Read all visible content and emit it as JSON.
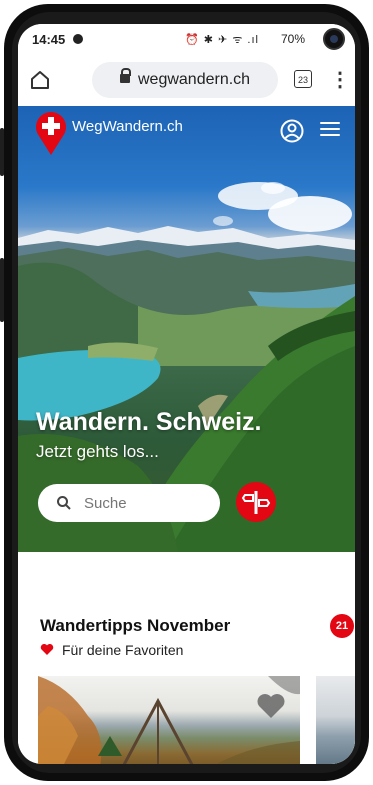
{
  "statusbar": {
    "time": "14:45",
    "icons": "⏰ ✱ ✈ ᯤ .ıl",
    "battery": "70%"
  },
  "browser": {
    "url": "wegwandern.ch",
    "tab_count": "23"
  },
  "hero": {
    "logo_text": "WegWandern.ch",
    "title": "Wandern. Schweiz.",
    "subtitle": "Jetzt gehts los...",
    "search_placeholder": "Suche"
  },
  "section": {
    "title": "Wandertipps November",
    "badge_count": "21",
    "favorites_label": "Für deine Favoriten"
  },
  "colors": {
    "brand_red": "#e30613"
  }
}
